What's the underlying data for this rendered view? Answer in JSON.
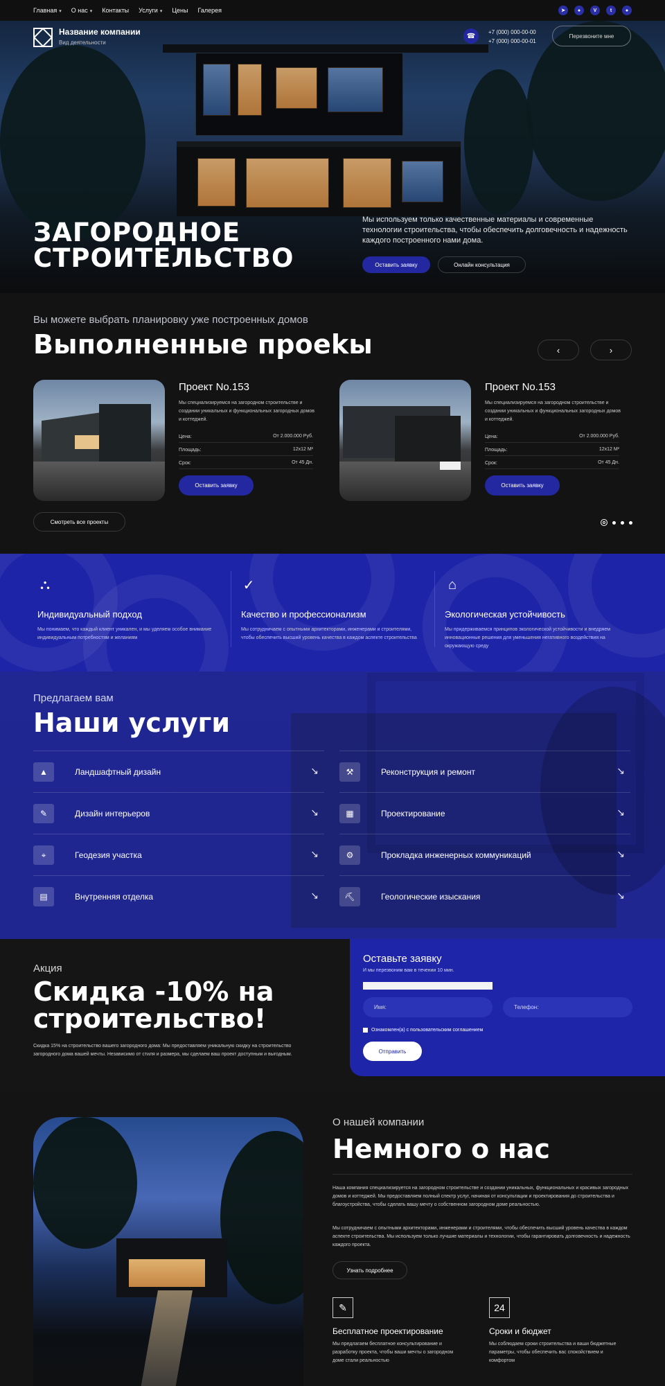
{
  "nav": {
    "items": [
      "Главная",
      "О нас",
      "Контакты",
      "Услуги",
      "Цены",
      "Галерея"
    ],
    "social": [
      "tg",
      "wa",
      "vk",
      "tw",
      "ok"
    ]
  },
  "hero": {
    "company_name": "Название компании",
    "company_sub": "Вид деятельности",
    "phone_1": "+7 (000) 000-00-00",
    "phone_2": "+7 (000) 000-00-01",
    "callback": "Перезвоните мне",
    "title_1": "ЗАГОРОДНОЕ",
    "title_2": "СТРОИТЕЛЬСТВО",
    "text": "Мы используем только качественные материалы и современные технологии строительства, чтобы обеспечить долговечность и надежность каждого построенного нами дома.",
    "btn_request": "Оставить заявку",
    "btn_consult": "Онлайн консультация"
  },
  "projects": {
    "subtitle": "Вы можете выбрать планировку уже построенных домов",
    "title": "Выполненные проеkы",
    "all": "Смотреть все проекты",
    "cards": [
      {
        "title": "Проект No.153",
        "text": "Мы специализируемся на загородном строительстве и создании уникальных и функциональных загородных домов и коттеджей.",
        "price_label": "Цена:",
        "price": "От 2.000.000 Руб.",
        "area_label": "Площадь:",
        "area": "12x12 M²",
        "term_label": "Срок:",
        "term": "От 45 Дн.",
        "btn": "Оставить заявку"
      },
      {
        "title": "Проект No.153",
        "text": "Мы специализируемся на загородном строительстве и создании уникальных и функциональных загородных домов и коттеджей.",
        "price_label": "Цена:",
        "price": "От 2.000.000 Руб.",
        "area_label": "Площадь:",
        "area": "12x12 M²",
        "term_label": "Срок:",
        "term": "От 45 Дн.",
        "btn": "Оставить заявку"
      }
    ]
  },
  "features": [
    {
      "icon": "network-icon",
      "title": "Индивидуальный подход",
      "text": "Мы понимаем, что каждый клиент уникален, и мы уделяем особое внимание индивидуальным потребностям и желаниям"
    },
    {
      "icon": "checkmark-icon",
      "title": "Качество и профессионализм",
      "text": "Мы сотрудничаем с опытными архитекторами, инженерами и строителями, чтобы обеспечить высший уровень качества в каждом аспекте строительства"
    },
    {
      "icon": "eco-house-icon",
      "title": "Экологическая устойчивость",
      "text": "Мы придерживаемся принципов экологической устойчивости и внедряем инновационные решения для уменьшения негативного воздействия на окружающую среду"
    }
  ],
  "services": {
    "subtitle": "Предлагаем вам",
    "title": "Наши услуги",
    "items": [
      {
        "label": "Ландшафтный дизайн",
        "icon": "landscape-icon"
      },
      {
        "label": "Реконструкция и ремонт",
        "icon": "repair-icon"
      },
      {
        "label": "Дизайн интерьеров",
        "icon": "interior-icon"
      },
      {
        "label": "Проектирование",
        "icon": "blueprint-icon"
      },
      {
        "label": "Геодезия участка",
        "icon": "survey-icon"
      },
      {
        "label": "Прокладка инженерных коммуникаций",
        "icon": "engineering-icon"
      },
      {
        "label": "Внутренняя отделка",
        "icon": "finishing-icon"
      },
      {
        "label": "Геологические изыскания",
        "icon": "geology-icon"
      }
    ]
  },
  "promo": {
    "subtitle": "Акция",
    "title": "Скидка -10% на строительство!",
    "text": "Скидка 15% на строительство вашего загородного дома: Мы предоставляем уникальную скидку на строительство загородного дома вашей мечты. Независимо от стиля и размера, мы сделаем ваш проект доступным и выгодным."
  },
  "form": {
    "title": "Оставьте заявку",
    "subtitle": "И мы перезвоним вам в течении 10 мин.",
    "name_placeholder": "Имя:",
    "phone_placeholder": "Телефон:",
    "agreement": "Ознакомлен(а) с пользовательским соглашением",
    "submit": "Отправить"
  },
  "about": {
    "subtitle": "О нашей компании",
    "title": "Немного о нас",
    "p1": "Наша компания специализируется на загородном строительстве и создании уникальных, функциональных и красивых загородных домов и коттеджей. Мы предоставляем полный спектр услуг, начиная от консультации и проектирования до строительства и благоустройства, чтобы сделать вашу мечту о собственном загородном доме реальностью.",
    "p2": "Мы сотрудничаем с опытными архитекторами, инженерами и строителями, чтобы обеспечить высший уровень качества в каждом аспекте строительства. Мы используем только лучшие материалы и технологии, чтобы гарантировать долговечность и надежность каждого проекта.",
    "more": "Узнать подробнее",
    "features": [
      {
        "title": "Бесплатное проектирование",
        "text": "Мы предлагаем бесплатное консультирование и разработку проекта, чтобы ваши мечты о загородном доме стали реальностью"
      },
      {
        "title": "Сроки и бюджет",
        "text": "Мы соблюдаем сроки строительства и ваши бюджетные параметры, чтобы обеспечить вас спокойствием и комфортом"
      }
    ]
  },
  "colors": {
    "accent": "#2328a0",
    "blue_section": "#1e24a8"
  }
}
